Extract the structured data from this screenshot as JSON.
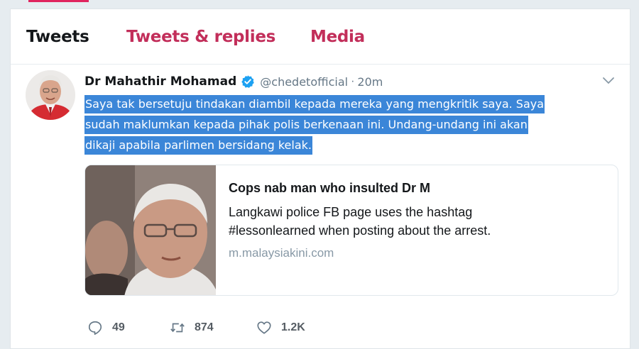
{
  "tabs": {
    "tweets": "Tweets",
    "replies": "Tweets & replies",
    "media": "Media"
  },
  "tweet": {
    "display_name": "Dr Mahathir Mohamad",
    "handle": "@chedetofficial",
    "separator": "·",
    "time": "20m",
    "text_lines": [
      "Saya tak bersetuju tindakan diambil kepada mereka yang mengkritik saya. Saya",
      "sudah maklumkan kepada pihak polis berkenaan ini. Undang-undang ini akan",
      "dikaji apabila parlimen bersidang kelak."
    ],
    "card": {
      "title": "Cops nab man who insulted Dr M",
      "description_lines": [
        "Langkawi police FB page uses the hashtag",
        "#lessonlearned when posting about the arrest."
      ],
      "domain": "m.malaysiakini.com"
    },
    "actions": {
      "replies": "49",
      "retweets": "874",
      "likes": "1.2K"
    }
  },
  "icons": {
    "verified": "verified-badge-icon",
    "caret": "chevron-down-icon",
    "reply": "reply-icon",
    "retweet": "retweet-icon",
    "like": "heart-icon"
  },
  "colors": {
    "accent": "#e0245e",
    "tab_inactive": "#c22e5a",
    "selection": "#3b86d8",
    "verified": "#1da1f2",
    "muted": "#657786"
  }
}
